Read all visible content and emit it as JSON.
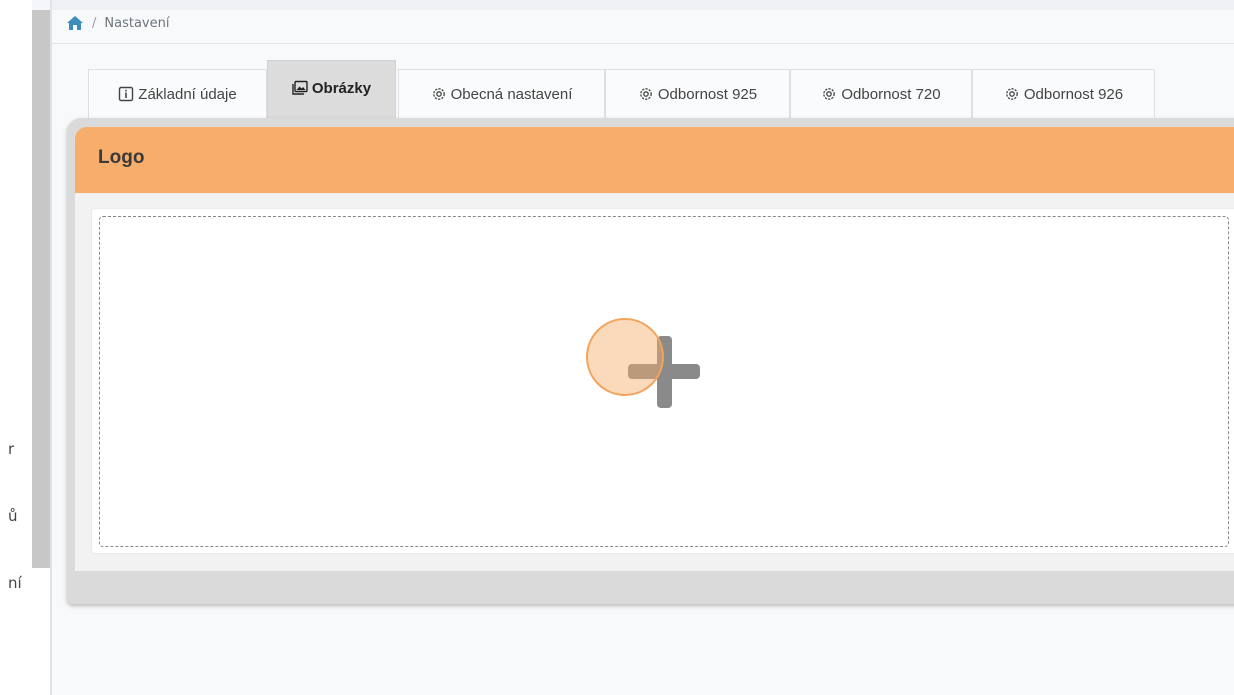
{
  "breadcrumb": {
    "home_icon": "home-icon",
    "separator": "/",
    "current": "Nastavení"
  },
  "sidebar": {
    "fragments": [
      "r",
      "ů",
      "ní"
    ]
  },
  "tabs": [
    {
      "label": "Základní údaje",
      "icon": "info-square-icon",
      "active": false
    },
    {
      "label": "Obrázky",
      "icon": "images-icon",
      "active": true
    },
    {
      "label": "Obecná nastavení",
      "icon": "gear-icon",
      "active": false
    },
    {
      "label": "Odbornost 925",
      "icon": "gear-icon",
      "active": false
    },
    {
      "label": "Odbornost 720",
      "icon": "gear-icon",
      "active": false
    },
    {
      "label": "Odbornost 926",
      "icon": "gear-icon",
      "active": false
    }
  ],
  "card": {
    "title": "Logo",
    "dropzone_icon": "plus-icon"
  },
  "colors": {
    "header_accent": "#f7ad6b",
    "home_icon": "#3c8dbc",
    "active_tab": "#dcdcdc"
  }
}
